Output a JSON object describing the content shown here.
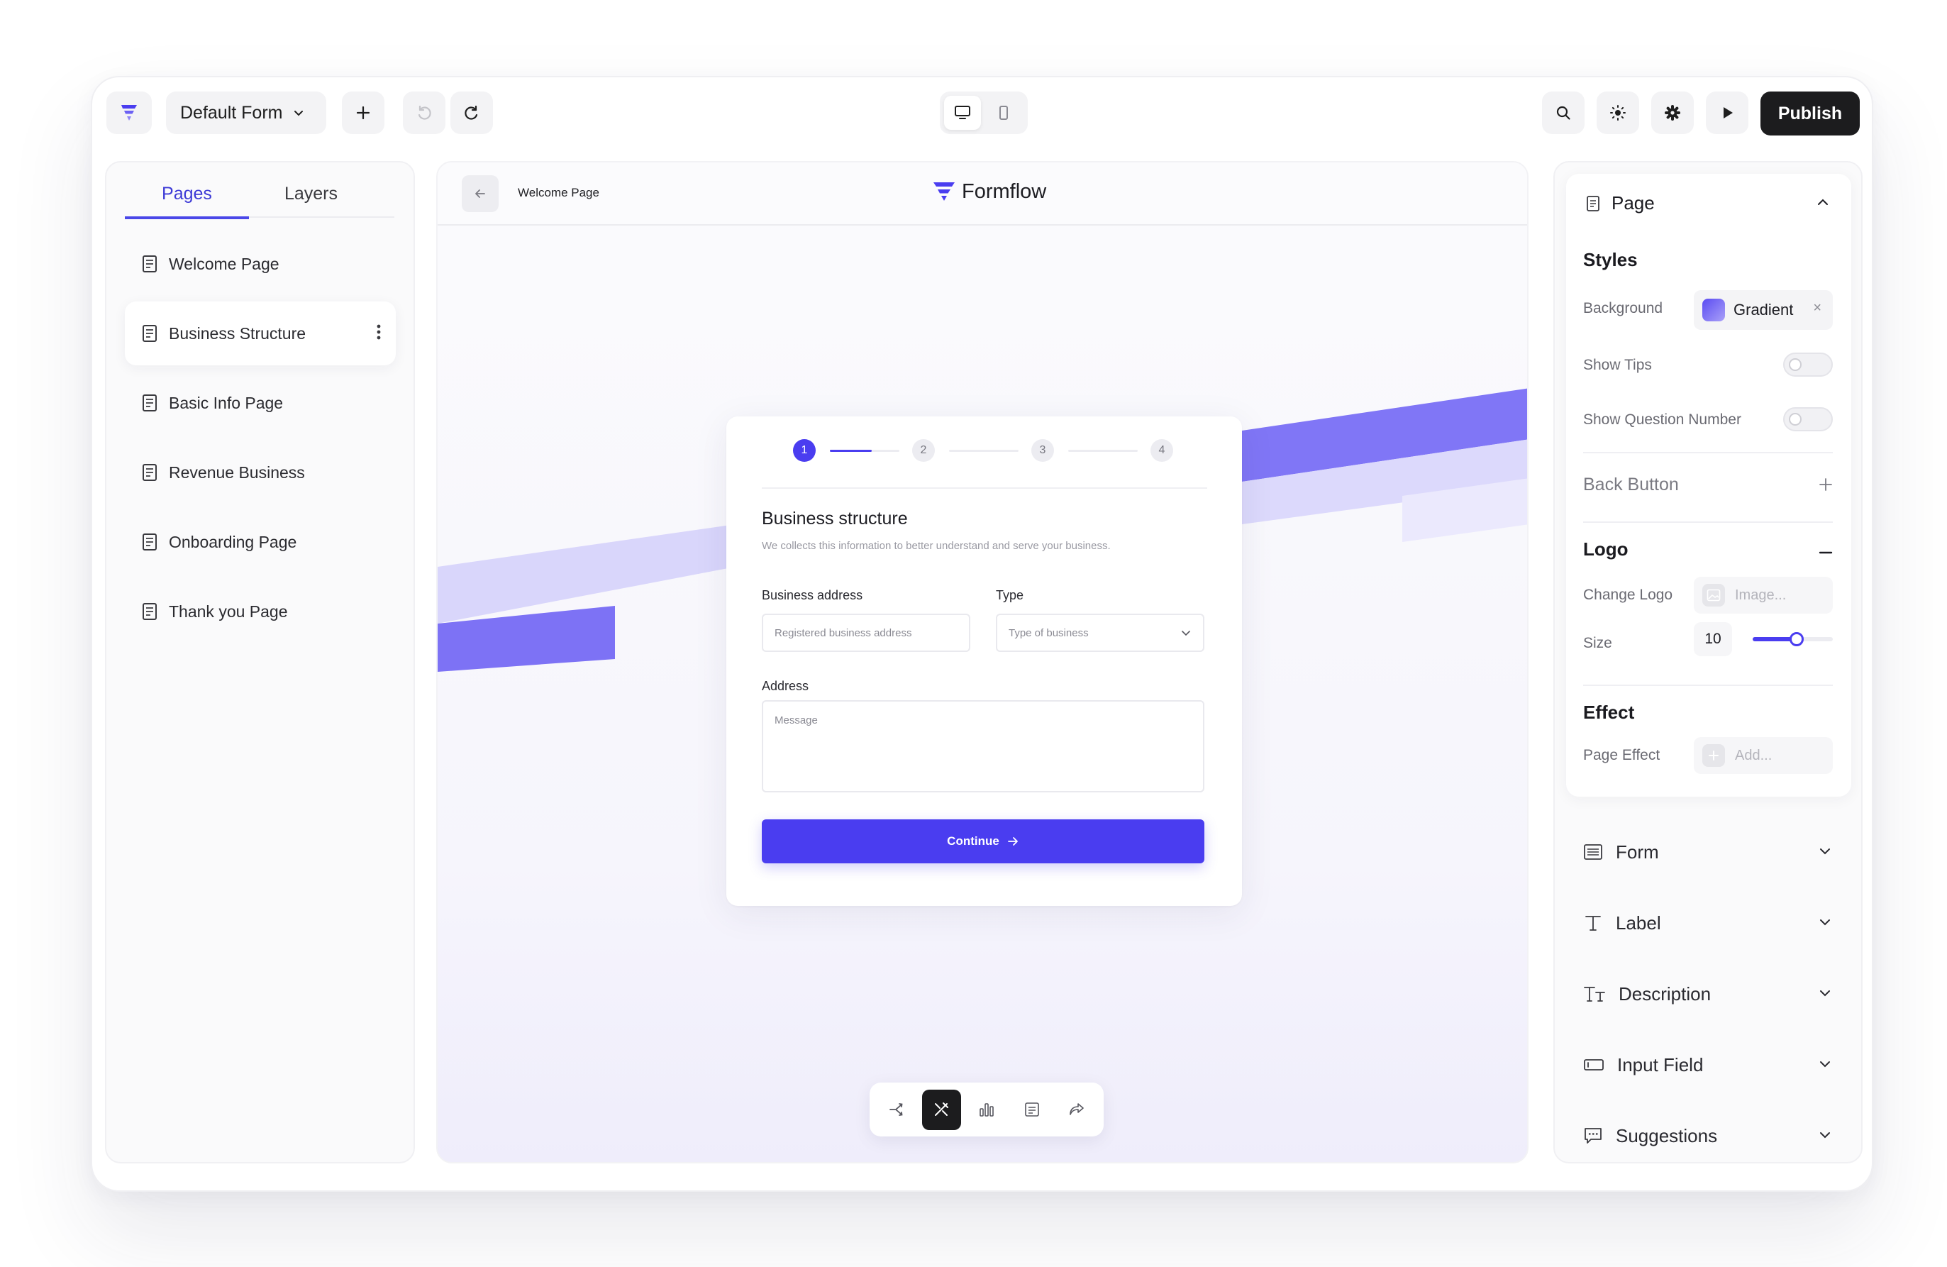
{
  "topbar": {
    "form_name": "Default Form",
    "publish_label": "Publish",
    "icons": [
      "logo-icon",
      "chevron-down-icon",
      "plus-icon",
      "undo-icon",
      "redo-icon",
      "desktop-icon",
      "mobile-icon",
      "search-icon",
      "sun-icon",
      "gear-icon",
      "play-icon"
    ]
  },
  "left_panel": {
    "tabs": [
      {
        "label": "Pages",
        "active": true
      },
      {
        "label": "Layers",
        "active": false
      }
    ],
    "pages": [
      {
        "label": "Welcome Page"
      },
      {
        "label": "Business Structure",
        "active": true
      },
      {
        "label": "Basic Info Page"
      },
      {
        "label": "Revenue Business"
      },
      {
        "label": "Onboarding Page"
      },
      {
        "label": "Thank you Page"
      }
    ]
  },
  "canvas": {
    "page_title": "Welcome Page",
    "brand": "Formflow",
    "accent_color": "#4a3df0",
    "form": {
      "steps": [
        "1",
        "2",
        "3",
        "4"
      ],
      "active_step": 1,
      "step_progress": 0.6,
      "title": "Business structure",
      "description": "We collects this information to better understand and serve your business.",
      "business_address_label": "Business address",
      "business_address_placeholder": "Registered business address",
      "type_label": "Type",
      "type_placeholder": "Type of business",
      "address_label": "Address",
      "address_placeholder": "Message",
      "continue_label": "Continue"
    },
    "bottom_tools": [
      "flow-icon",
      "design-icon",
      "analytics-icon",
      "document-icon",
      "share-icon"
    ]
  },
  "right_panel": {
    "page_section": "Page",
    "styles_title": "Styles",
    "background_label": "Background",
    "background_value": "Gradient",
    "show_tips_label": "Show Tips",
    "show_tips": false,
    "show_question_number_label": "Show Question Number",
    "show_question_number": false,
    "back_button_label": "Back Button",
    "logo_title": "Logo",
    "change_logo_label": "Change Logo",
    "change_logo_placeholder": "Image...",
    "size_label": "Size",
    "size_value": "10",
    "size_slider_fraction": 0.55,
    "effect_title": "Effect",
    "page_effect_label": "Page Effect",
    "page_effect_placeholder": "Add...",
    "sections": [
      {
        "label": "Form",
        "icon": "form-icon"
      },
      {
        "label": "Label",
        "icon": "text-icon"
      },
      {
        "label": "Description",
        "icon": "text-size-icon"
      },
      {
        "label": "Input Field",
        "icon": "input-field-icon"
      },
      {
        "label": "Suggestions",
        "icon": "chat-icon"
      }
    ]
  }
}
